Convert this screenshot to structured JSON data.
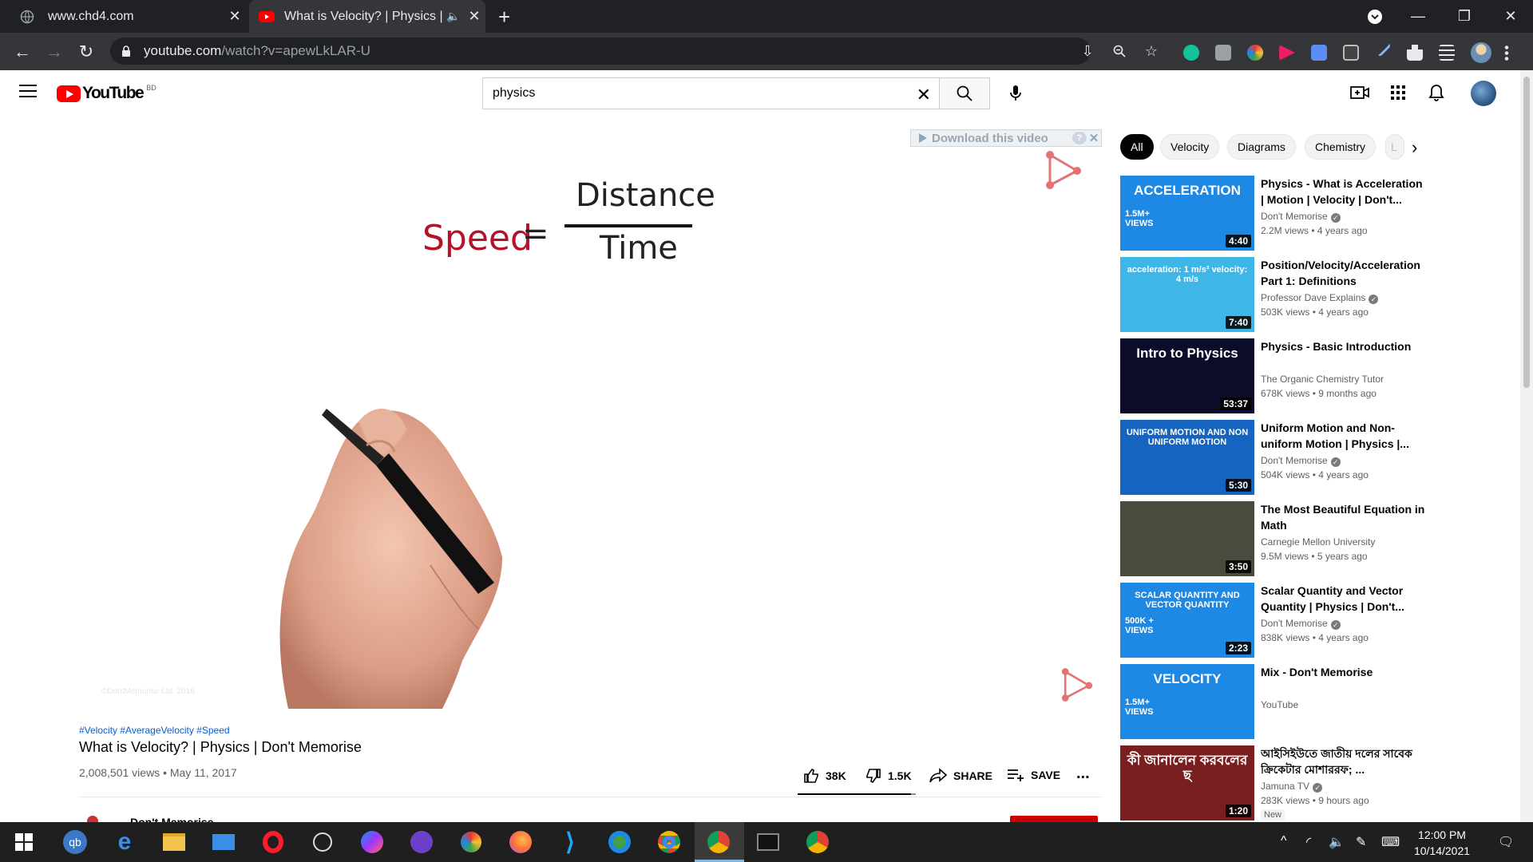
{
  "browser": {
    "tabs": [
      {
        "title": "www.chd4.com",
        "active": false
      },
      {
        "title": "What is Velocity? | Physics | D",
        "active": true
      }
    ],
    "url_host": "youtube.com",
    "url_path": "/watch?v=apewLkLAR-U"
  },
  "youtube": {
    "logo_text": "YouTube",
    "country_code": "BD",
    "search_value": "physics",
    "search_placeholder": "Search"
  },
  "video": {
    "download_label": "Download this video",
    "download_help": "?",
    "formula": {
      "lhs": "Speed",
      "eq": "=",
      "numerator": "Distance",
      "denominator": "Time"
    },
    "watermark": "©DontMemorise Ltd. 2016",
    "hashtags": "#Velocity #AverageVelocity #Speed",
    "title": "What is Velocity? | Physics | Don't Memorise",
    "meta": "2,008,501 views • May 11, 2017",
    "likes": "38K",
    "dislikes": "1.5K",
    "like_ratio": 0.96,
    "share_label": "SHARE",
    "save_label": "SAVE",
    "more_label": "...",
    "channel": "Don't Memorise"
  },
  "chips": [
    "All",
    "Velocity",
    "Diagrams",
    "Chemistry",
    "L"
  ],
  "recommendations": [
    {
      "title": "Physics - What is Acceleration | Motion | Velocity | Don't...",
      "channel": "Don't Memorise",
      "verified": true,
      "views": "2.2M views • 4 years ago",
      "duration": "4:40",
      "thumb_text": "ACCELERATION",
      "thumb_sub": "1.5M+ VIEWS",
      "thumb_color": "#1e88e5"
    },
    {
      "title": "Position/Velocity/Acceleration Part 1: Definitions",
      "channel": "Professor Dave Explains",
      "verified": true,
      "views": "503K views • 4 years ago",
      "duration": "7:40",
      "thumb_text": "acceleration: 1 m/s²   velocity: 4 m/s",
      "thumb_sub": "",
      "thumb_color": "#3fb6e8"
    },
    {
      "title": "Physics - Basic Introduction",
      "channel": "The Organic Chemistry Tutor",
      "verified": false,
      "views": "678K views • 9 months ago",
      "duration": "53:37",
      "thumb_text": "Intro to Physics",
      "thumb_sub": "",
      "thumb_color": "#0b0b2a"
    },
    {
      "title": "Uniform Motion and Non-uniform Motion | Physics |...",
      "channel": "Don't Memorise",
      "verified": true,
      "views": "504K views • 4 years ago",
      "duration": "5:30",
      "thumb_text": "UNIFORM MOTION AND NON UNIFORM MOTION",
      "thumb_sub": "",
      "thumb_color": "#1565c0"
    },
    {
      "title": "The Most Beautiful Equation in Math",
      "channel": "Carnegie Mellon University",
      "verified": false,
      "views": "9.5M views • 5 years ago",
      "duration": "3:50",
      "thumb_text": "",
      "thumb_sub": "",
      "thumb_color": "#4b4a3e"
    },
    {
      "title": "Scalar Quantity and Vector Quantity | Physics | Don't...",
      "channel": "Don't Memorise",
      "verified": true,
      "views": "838K views • 4 years ago",
      "duration": "2:23",
      "thumb_text": "SCALAR QUANTITY AND VECTOR QUANTITY",
      "thumb_sub": "500K + VIEWS",
      "thumb_color": "#1e88e5"
    },
    {
      "title": "Mix - Don't Memorise",
      "channel": "YouTube",
      "verified": false,
      "views": "",
      "duration": "",
      "thumb_text": "VELOCITY",
      "thumb_sub": "1.5M+ VIEWS",
      "thumb_color": "#1e88e5"
    },
    {
      "title": "আইসিইউতে জাতীয় দলের সাবেক ক্রিকেটার মোশাররফ; ...",
      "channel": "Jamuna TV",
      "verified": true,
      "views": "283K views • 9 hours ago",
      "duration": "1:20",
      "thumb_text": "কী জানালেন করবলের ছ",
      "thumb_sub": "",
      "thumb_color": "#7a1f1f",
      "badge": "New"
    }
  ],
  "taskbar": {
    "time": "12:00 PM",
    "date": "10/14/2021"
  }
}
